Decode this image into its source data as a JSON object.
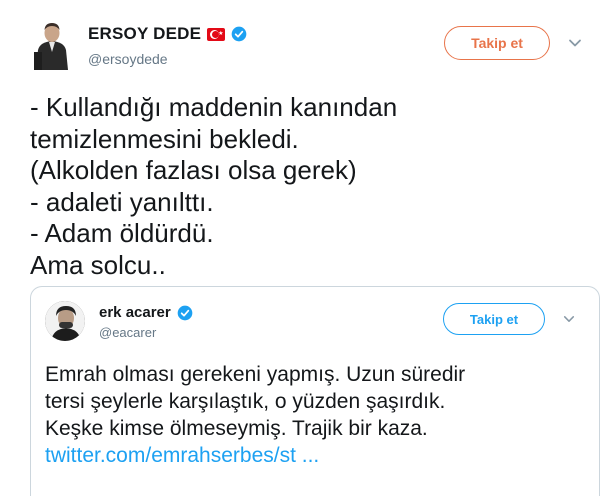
{
  "tweet": {
    "author": {
      "name": "ERSOY DEDE",
      "handle": "@ersoydede"
    },
    "follow_label": "Takip et",
    "lines": [
      "- Kullandığı maddenin kanından",
      "temizlenmesini bekledi.",
      "(Alkolden fazlası olsa gerek)",
      "- adaleti yanılttı.",
      "- Adam öldürdü.",
      "Ama solcu.."
    ]
  },
  "quoted_tweet": {
    "author": {
      "name": "erk acarer",
      "handle": "@eacarer"
    },
    "follow_label": "Takip et",
    "lines": [
      "Emrah olması gerekeni yapmış. Uzun süredir",
      "tersi şeylerle karşılaştık, o yüzden şaşırdık.",
      "Keşke kimse ölmeseymiş. Trajik bir kaza."
    ],
    "link": "twitter.com/emrahserbes/st ..."
  },
  "colors": {
    "follow_accent_orange": "#e8744a",
    "follow_accent_blue": "#1da1f2",
    "verified_blue": "#1da1f2",
    "handle_gray": "#657786",
    "flag_red": "#e30a17"
  },
  "icons": {
    "flag": "turkey-flag-icon",
    "verified": "verified-badge-icon",
    "more": "chevron-down-icon"
  }
}
